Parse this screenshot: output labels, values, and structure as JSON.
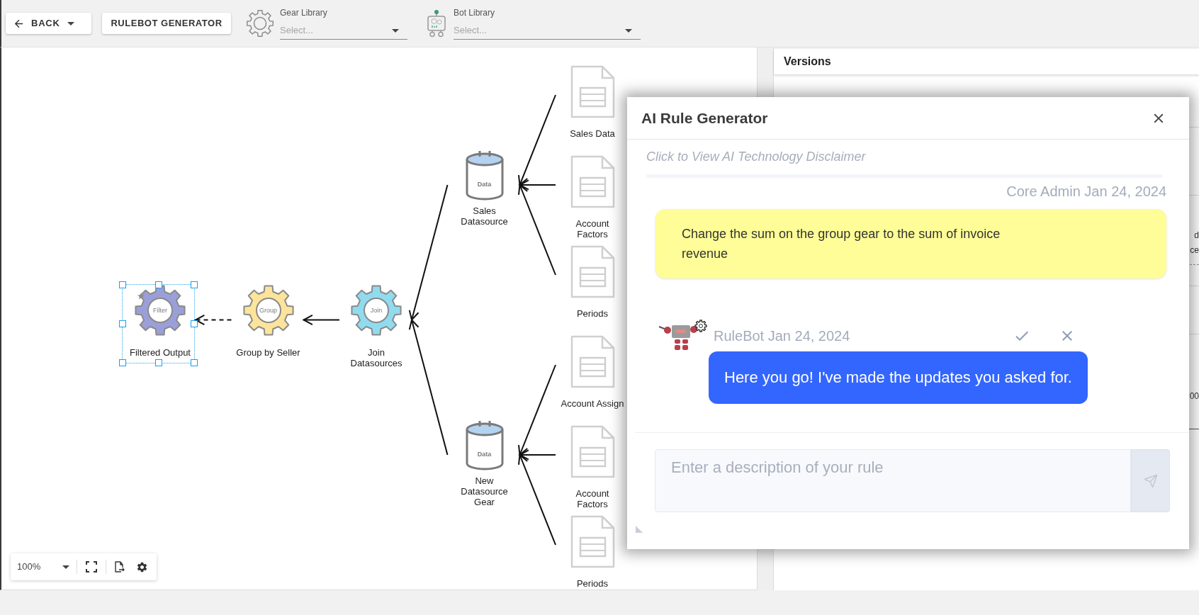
{
  "toolbar": {
    "back_button": {
      "label": "BACK"
    },
    "generator_button": {
      "label": "RULEBOT GENERATOR"
    },
    "libraries": [
      {
        "kind": "gear",
        "label": "Gear Library",
        "placeholder": "Select..."
      },
      {
        "kind": "bot",
        "label": "Bot Library",
        "placeholder": "Select..."
      }
    ]
  },
  "canvas": {
    "flow": {
      "kind": "gear",
      "label": "Filtered Output",
      "icon_text": "Filter",
      "color": "#9b9fd9",
      "selected": true,
      "starred": true,
      "sources": [
        {
          "kind": "gear",
          "label": "Group by Seller",
          "icon_text": "Group",
          "color": "#fde49b",
          "selected": false,
          "starred": false,
          "dashed": true,
          "sources": [
            {
              "kind": "gear",
              "label": "Join Datasources",
              "icon_text": "Join",
              "color": "#90dbee",
              "selected": false,
              "starred": false,
              "dashed": false,
              "sources": [
                {
                  "kind": "datasource",
                  "label": "Sales Datasource",
                  "icon_text": "Data",
                  "selected": false,
                  "dashed": false,
                  "sources": [
                    {
                      "kind": "document",
                      "label": "Sales Data",
                      "selected": false,
                      "dashed": false
                    },
                    {
                      "kind": "document",
                      "label": "Account Factors",
                      "selected": false,
                      "dashed": false
                    },
                    {
                      "kind": "document",
                      "label": "Periods",
                      "selected": false,
                      "dashed": false
                    }
                  ]
                },
                {
                  "kind": "datasource",
                  "label": "New Datasource Gear",
                  "icon_text": "Data",
                  "selected": false,
                  "dashed": false,
                  "sources": [
                    {
                      "kind": "document",
                      "label": "Account Assign",
                      "selected": false,
                      "dashed": false
                    },
                    {
                      "kind": "document",
                      "label": "Account Factors",
                      "selected": false,
                      "dashed": false
                    },
                    {
                      "kind": "document",
                      "label": "Periods",
                      "selected": false,
                      "dashed": false
                    }
                  ]
                }
              ]
            }
          ]
        }
      ]
    },
    "zoom_control": {
      "value": "100%"
    }
  },
  "side_panel": {
    "title": "Versions",
    "fragments": [
      "d",
      "ce",
      "00"
    ]
  },
  "dialog": {
    "title": "AI Rule Generator",
    "disclaimer": "Click to View AI Technology Disclaimer",
    "messages": [
      {
        "kind": "user",
        "meta": "Core Admin Jan 24, 2024",
        "text": "Change the sum on the group gear to the sum of invoice revenue"
      },
      {
        "kind": "bot",
        "meta": "RuleBot Jan 24, 2024",
        "text": "Here you go! I've made the updates you asked for."
      }
    ],
    "input": {
      "placeholder": "Enter a description of your rule"
    }
  }
}
